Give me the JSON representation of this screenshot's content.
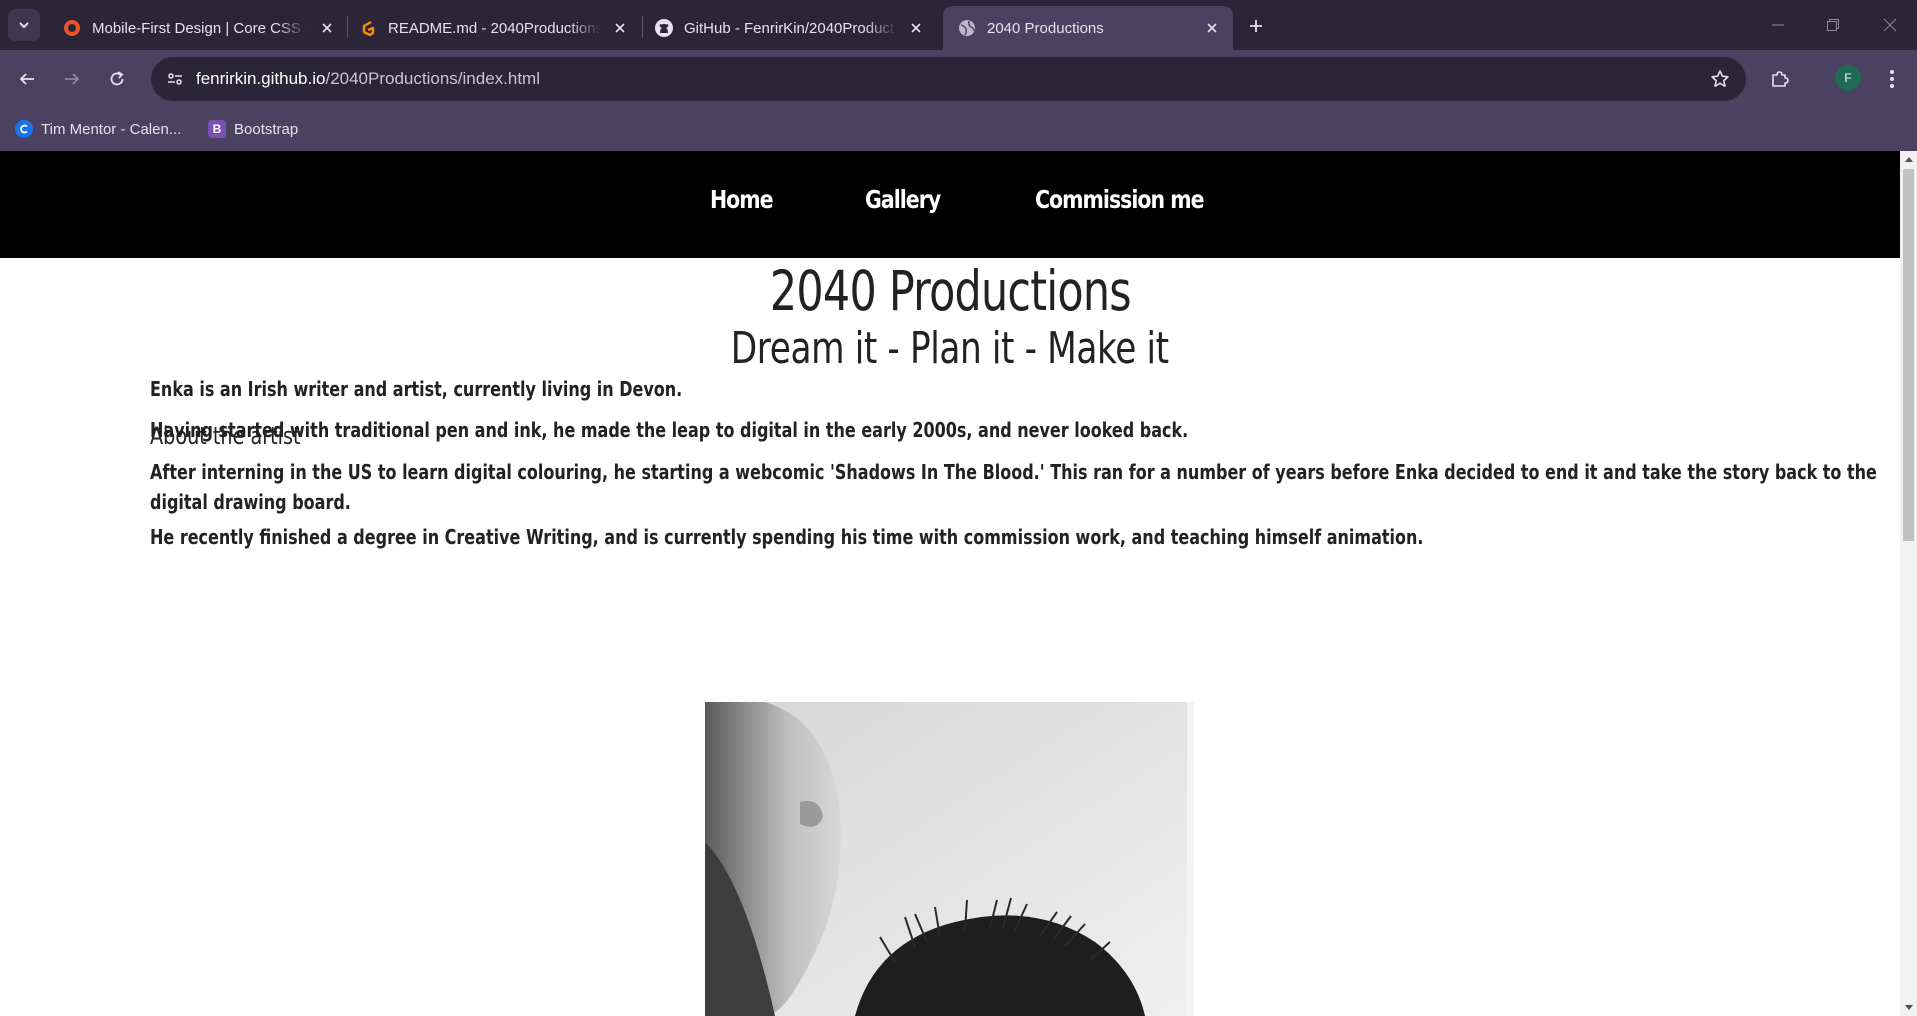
{
  "browser": {
    "tabs": [
      {
        "title": "Mobile-First Design | Core CSS &",
        "favicon": "code-institute-icon",
        "active": false
      },
      {
        "title": "README.md - 2040Productions - Gi",
        "favicon": "gitpod-icon",
        "active": false
      },
      {
        "title": "GitHub - FenrirKin/2040Product",
        "favicon": "github-icon",
        "active": false
      },
      {
        "title": "2040 Productions",
        "favicon": "globe-icon",
        "active": true
      }
    ],
    "url": {
      "host": "fenrirkin.github.io",
      "path": "/2040Productions/index.html"
    },
    "profile_initial": "F",
    "bookmarks": [
      {
        "label": "Tim Mentor - Calen...",
        "icon": "calendly-icon",
        "color": "#1a73e8"
      },
      {
        "label": "Bootstrap",
        "icon": "bootstrap-icon",
        "glyph": "B",
        "color": "#7952b3"
      }
    ]
  },
  "site": {
    "nav": {
      "home": "Home",
      "gallery": "Gallery",
      "commission": "Commission me"
    },
    "title": "2040 Productions",
    "tagline": "Dream it - Plan it - Make it",
    "about_heading": "About the artist",
    "paragraphs": [
      "Enka is an Irish writer and artist, currently living in Devon.",
      "Having started with traditional pen and ink, he made the leap to digital in the early 2000s, and never looked back.",
      "After interning in the US to learn digital colouring, he starting a webcomic 'Shadows In The Blood.' This ran for a number of years before Enka decided to end it and take the story back to the",
      "digital drawing board.",
      "He recently finished a degree in Creative Writing, and is currently spending his time with commission work, and teaching himself animation."
    ]
  },
  "colors": {
    "tab_bar": "#2b2637",
    "toolbar": "#4a4260",
    "site_nav": "#000000",
    "text": "#222222"
  }
}
